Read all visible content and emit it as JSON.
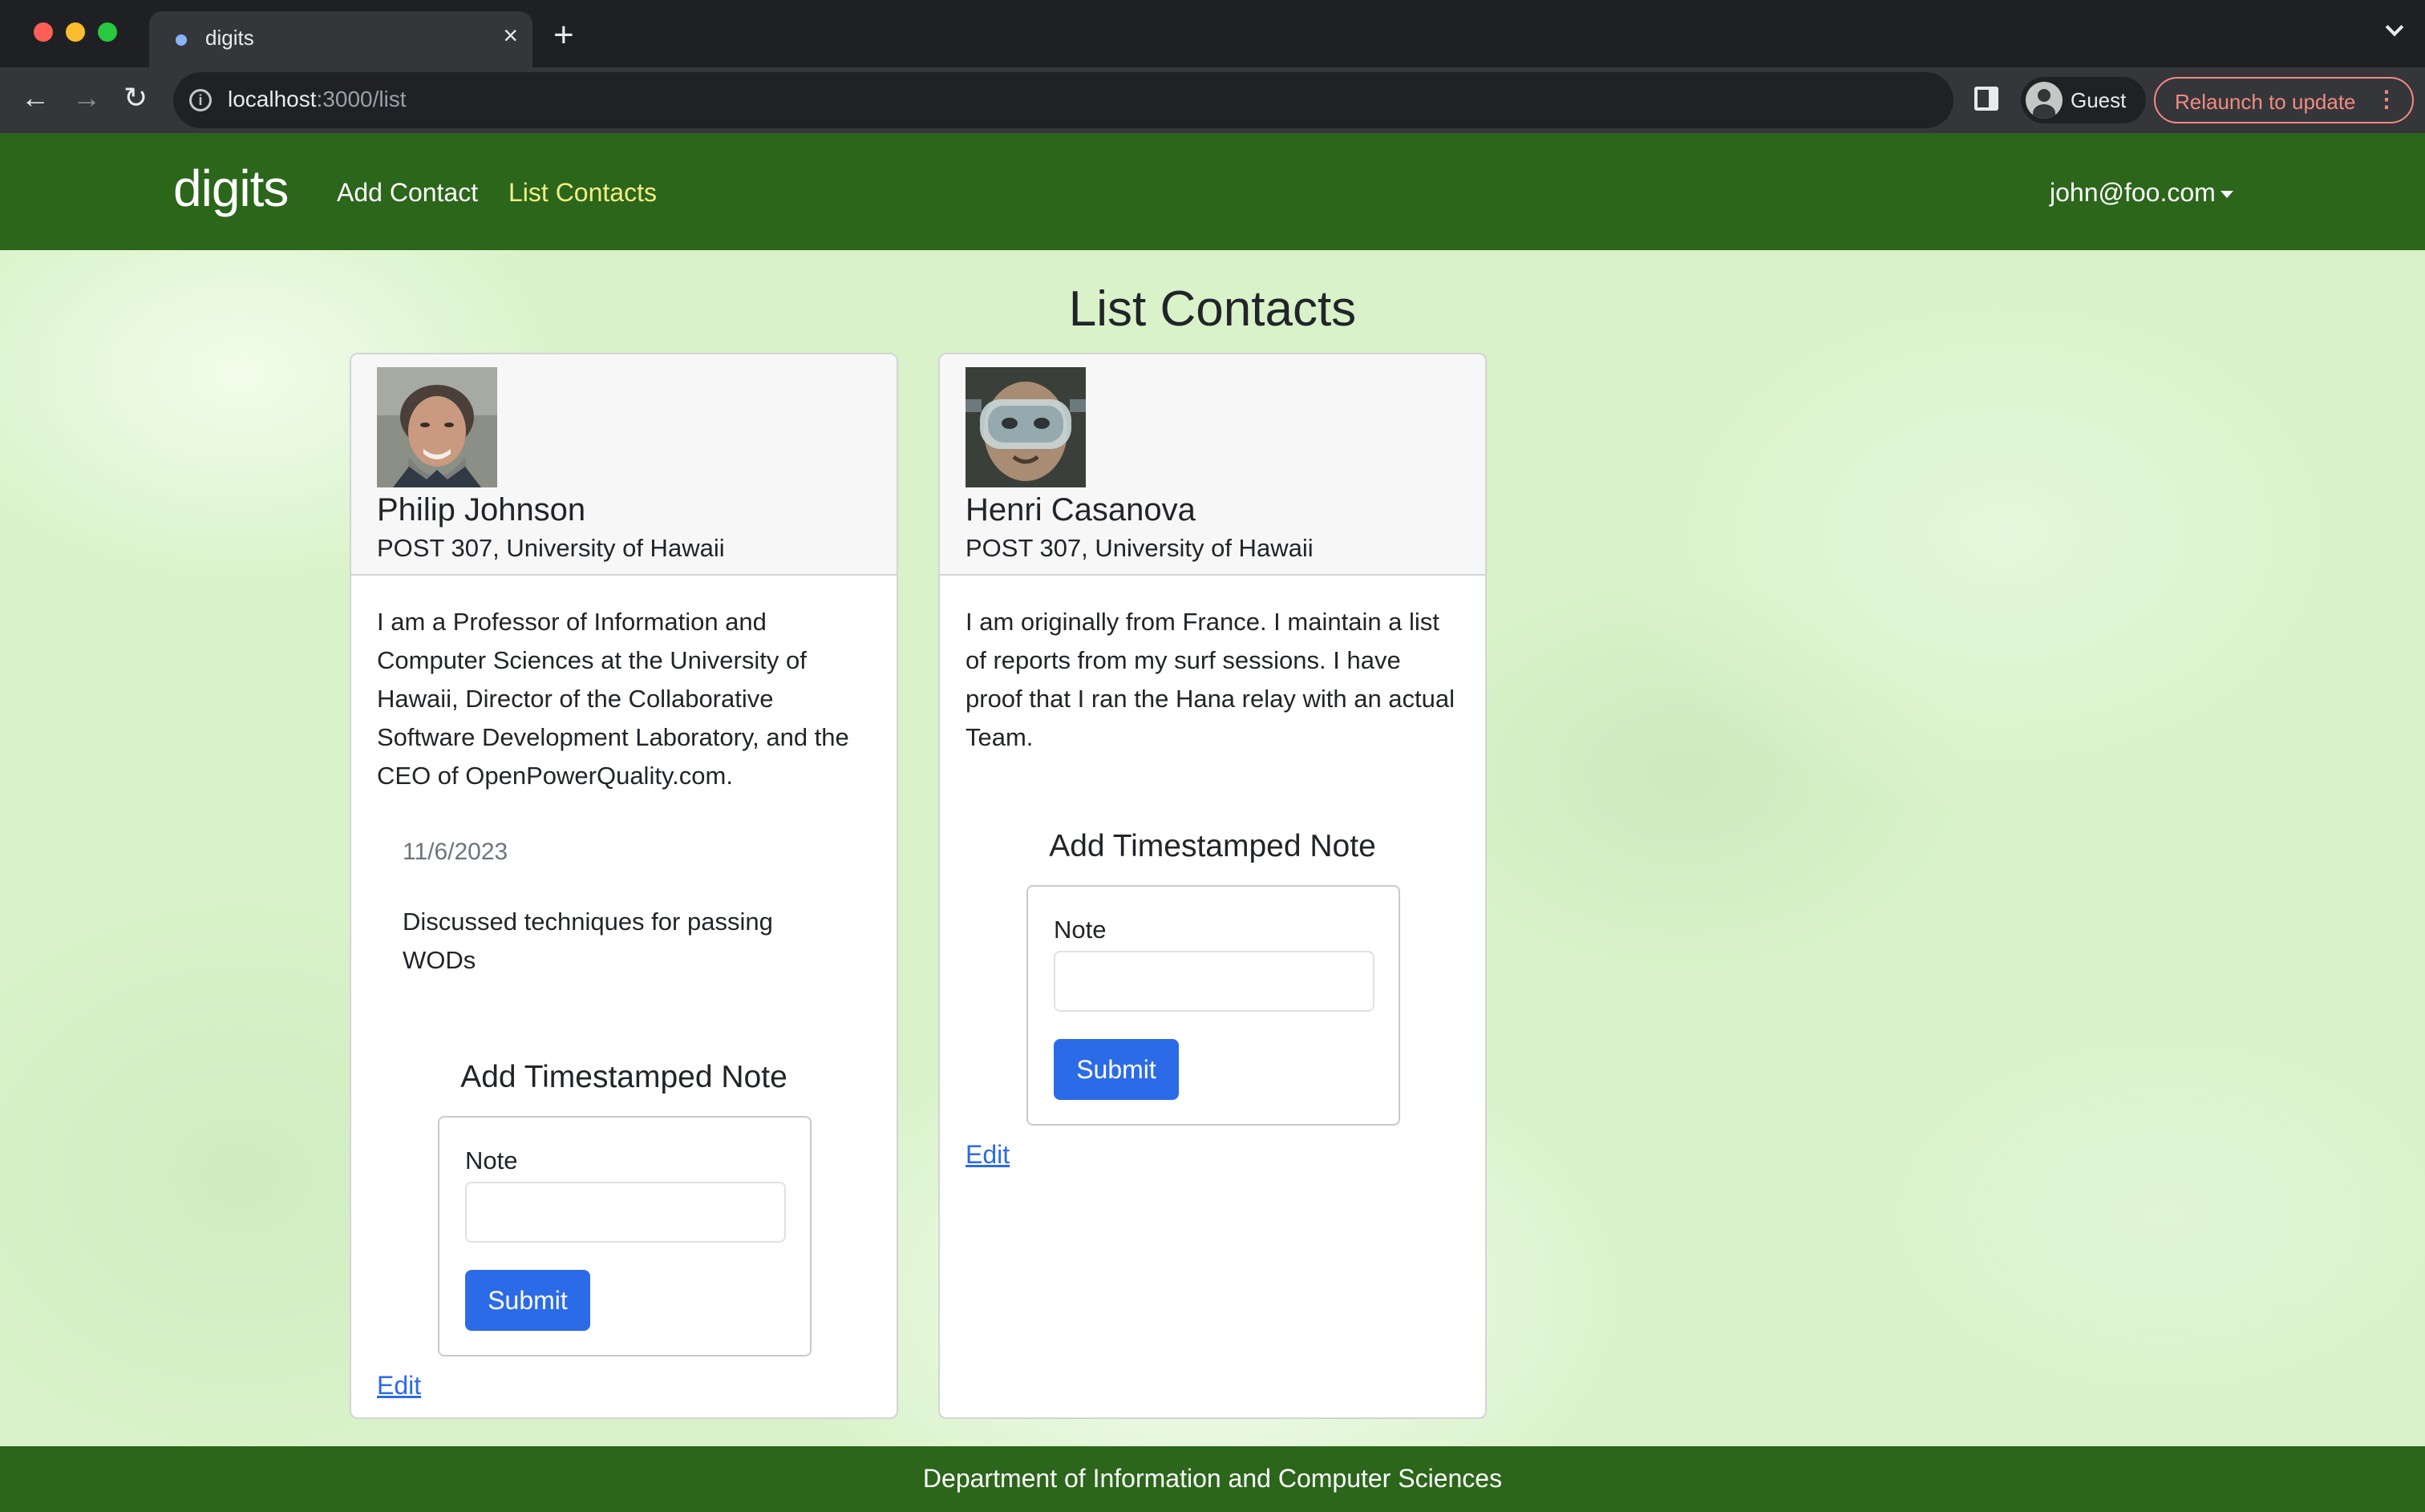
{
  "browser": {
    "tab_title": "digits",
    "url_host": "localhost",
    "url_path": ":3000/list",
    "profile_label": "Guest",
    "relaunch_label": "Relaunch to update"
  },
  "navbar": {
    "brand": "digits",
    "links": [
      "Add Contact",
      "List Contacts"
    ],
    "active_link": "List Contacts",
    "user": "john@foo.com"
  },
  "main": {
    "title": "List Contacts",
    "contacts": [
      {
        "name": "Philip Johnson",
        "address": "POST 307, University of Hawaii",
        "description": "I am a Professor of Information and Computer Sciences at the University of Hawaii, Director of the Collaborative Software Development Laboratory, and the CEO of OpenPowerQuality.com.",
        "notes": [
          {
            "date": "11/6/2023",
            "text": "Discussed techniques for passing WODs"
          }
        ],
        "add_note_heading": "Add Timestamped Note",
        "note_label": "Note",
        "note_value": "",
        "submit_label": "Submit",
        "edit_label": "Edit"
      },
      {
        "name": "Henri Casanova",
        "address": "POST 307, University of Hawaii",
        "description": "I am originally from France. I maintain a list of reports from my surf sessions. I have proof that I ran the Hana relay with an actual Team.",
        "notes": [],
        "add_note_heading": "Add Timestamped Note",
        "note_label": "Note",
        "note_value": "",
        "submit_label": "Submit",
        "edit_label": "Edit"
      }
    ]
  },
  "footer": {
    "text": "Department of Information and Computer Sciences"
  },
  "colors": {
    "navbar": "#2b661b",
    "active_link": "#f3ef84",
    "primary_button": "#2c6be8",
    "page_background": "#d9f2c9"
  }
}
